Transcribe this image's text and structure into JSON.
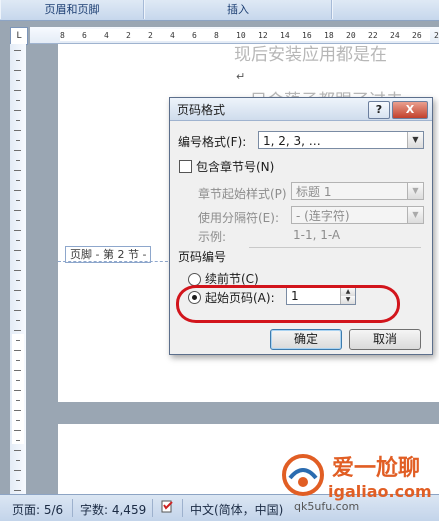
{
  "ribbon": {
    "btn1": "页眉和页脚",
    "btn2": "插入",
    "btn3": ""
  },
  "ruler": {
    "corner": "L",
    "ticks": [
      "8",
      "6",
      "4",
      "2",
      "2",
      "4",
      "6",
      "8",
      "10",
      "12",
      "14",
      "16",
      "18",
      "20",
      "22",
      "24",
      "26",
      "28"
    ]
  },
  "document": {
    "bg_text1": "现后安装应用都是在",
    "para_mark": "↵",
    "bg_text2": "只会落子都跟了过去",
    "footer_tab": "页脚 - 第 2 节 -"
  },
  "dialog": {
    "title": "页码格式",
    "help": "?",
    "close": "X",
    "number_format_label": "编号格式(F):",
    "number_format_value": "1, 2, 3, …",
    "include_chapter_label": "包含章节号(N)",
    "chapter_style_label": "章节起始样式(P)",
    "chapter_style_value": "标题 1",
    "separator_label": "使用分隔符(E):",
    "separator_value": "-  (连字符)",
    "example_label": "示例:",
    "example_value": "1-1, 1-A",
    "page_numbering_label": "页码编号",
    "continue_label": "续前节(C)",
    "start_at_label": "起始页码(A):",
    "start_at_value": "1",
    "ok": "确定",
    "cancel": "取消"
  },
  "statusbar": {
    "page": "页面: 5/6",
    "words": "字数: 4,459",
    "language": "中文(简体，中国)"
  },
  "watermark": {
    "line1": "爱一尬聊",
    "line2": "igaliao.com",
    "line3": "qk5ufu.com"
  },
  "colors": {
    "annotation": "#d2151c",
    "watermark": "#e15e24"
  }
}
